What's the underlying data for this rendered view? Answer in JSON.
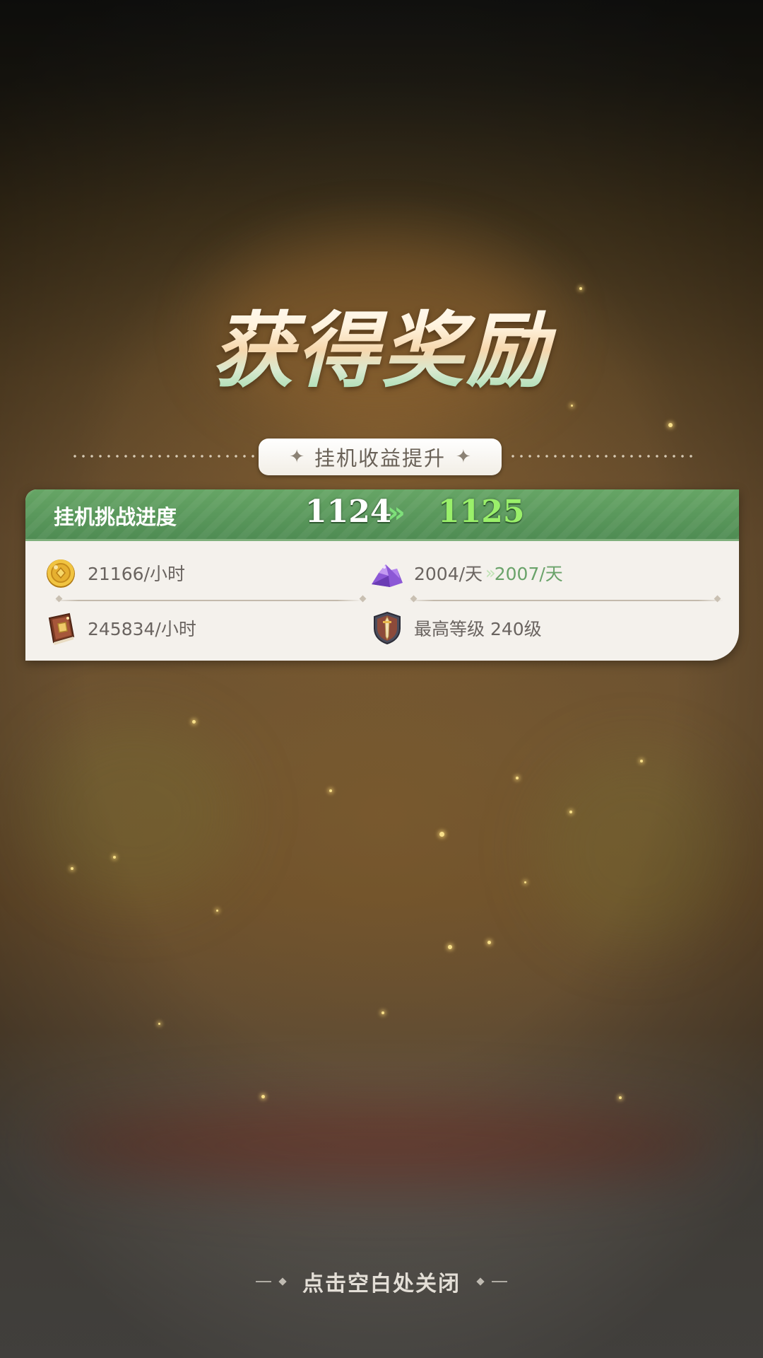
{
  "popup": {
    "title": "获得奖励",
    "subtitle": "挂机收益提升"
  },
  "progress": {
    "label": "挂机挑战进度",
    "from": "1124",
    "to": "1125",
    "arrow": "»"
  },
  "stats": {
    "gold": {
      "icon": "gold-coin-icon",
      "value": "21166/小时"
    },
    "exp": {
      "icon": "exp-book-icon",
      "value": "245834/小时"
    },
    "crystal": {
      "icon": "purple-crystal-icon",
      "from": "2004/天",
      "arrow": "»",
      "to": "2007/天"
    },
    "level": {
      "icon": "level-shield-icon",
      "value": "最高等级 240级"
    }
  },
  "footer": {
    "close_hint": "点击空白处关闭"
  },
  "colors": {
    "header_green": "#5d9a5c",
    "up_green": "#6aa36a",
    "card_bg": "#f4f1ec"
  }
}
